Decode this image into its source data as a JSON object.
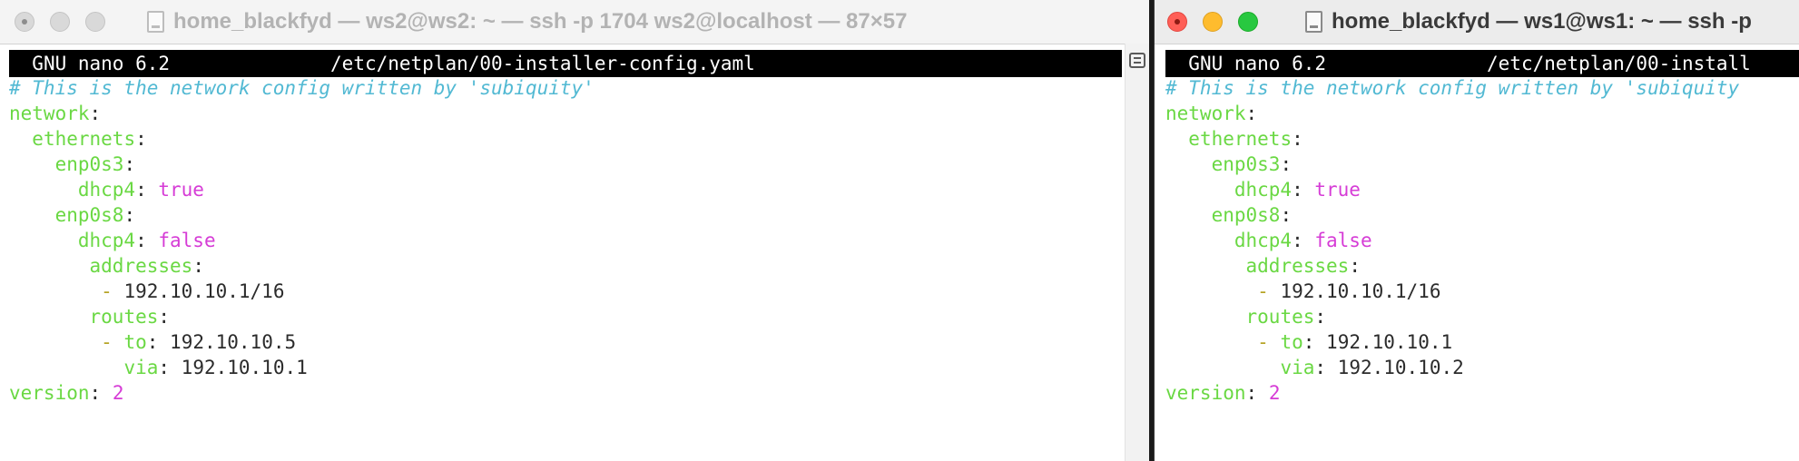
{
  "windows": [
    {
      "id": "ws2",
      "title": "home_blackfyd — ws2@ws2: ~ — ssh -p 1704 ws2@localhost — 87×57",
      "active": false,
      "nano": {
        "version_label": "GNU nano 6.2",
        "file_path": "/etc/netplan/00-installer-config.yaml"
      },
      "lines": [
        [
          {
            "c": "comment",
            "t": "# This is the network config written by 'subiquity'"
          }
        ],
        [
          {
            "c": "key",
            "t": "network"
          },
          {
            "c": "punc",
            "t": ":"
          }
        ],
        [
          {
            "c": "punc",
            "t": "  "
          },
          {
            "c": "key",
            "t": "ethernets"
          },
          {
            "c": "punc",
            "t": ":"
          }
        ],
        [
          {
            "c": "punc",
            "t": "    "
          },
          {
            "c": "key",
            "t": "enp0s3"
          },
          {
            "c": "punc",
            "t": ":"
          }
        ],
        [
          {
            "c": "punc",
            "t": "      "
          },
          {
            "c": "key",
            "t": "dhcp4"
          },
          {
            "c": "punc",
            "t": ": "
          },
          {
            "c": "bool",
            "t": "true"
          }
        ],
        [
          {
            "c": "punc",
            "t": "    "
          },
          {
            "c": "key",
            "t": "enp0s8"
          },
          {
            "c": "punc",
            "t": ":"
          }
        ],
        [
          {
            "c": "punc",
            "t": "      "
          },
          {
            "c": "key",
            "t": "dhcp4"
          },
          {
            "c": "punc",
            "t": ": "
          },
          {
            "c": "bool",
            "t": "false"
          }
        ],
        [
          {
            "c": "punc",
            "t": "       "
          },
          {
            "c": "key",
            "t": "addresses"
          },
          {
            "c": "punc",
            "t": ":"
          }
        ],
        [
          {
            "c": "punc",
            "t": "        "
          },
          {
            "c": "dash",
            "t": "- "
          },
          {
            "c": "val",
            "t": "192.10.10.1/16"
          }
        ],
        [
          {
            "c": "punc",
            "t": "       "
          },
          {
            "c": "key",
            "t": "routes"
          },
          {
            "c": "punc",
            "t": ":"
          }
        ],
        [
          {
            "c": "punc",
            "t": "        "
          },
          {
            "c": "dash",
            "t": "- "
          },
          {
            "c": "key",
            "t": "to"
          },
          {
            "c": "punc",
            "t": ": "
          },
          {
            "c": "val",
            "t": "192.10.10.5"
          }
        ],
        [
          {
            "c": "punc",
            "t": "          "
          },
          {
            "c": "key",
            "t": "via"
          },
          {
            "c": "punc",
            "t": ": "
          },
          {
            "c": "val",
            "t": "192.10.10.1"
          }
        ],
        [
          {
            "c": "key",
            "t": "version"
          },
          {
            "c": "punc",
            "t": ": "
          },
          {
            "c": "num",
            "t": "2"
          }
        ]
      ]
    },
    {
      "id": "ws1",
      "title": "home_blackfyd — ws1@ws1: ~ — ssh -p",
      "active": true,
      "nano": {
        "version_label": "GNU nano 6.2",
        "file_path": "/etc/netplan/00-install"
      },
      "lines": [
        [
          {
            "c": "comment",
            "t": "# This is the network config written by 'subiquity"
          }
        ],
        [
          {
            "c": "key",
            "t": "network"
          },
          {
            "c": "punc",
            "t": ":"
          }
        ],
        [
          {
            "c": "punc",
            "t": "  "
          },
          {
            "c": "key",
            "t": "ethernets"
          },
          {
            "c": "punc",
            "t": ":"
          }
        ],
        [
          {
            "c": "punc",
            "t": "    "
          },
          {
            "c": "key",
            "t": "enp0s3"
          },
          {
            "c": "punc",
            "t": ":"
          }
        ],
        [
          {
            "c": "punc",
            "t": "      "
          },
          {
            "c": "key",
            "t": "dhcp4"
          },
          {
            "c": "punc",
            "t": ": "
          },
          {
            "c": "bool",
            "t": "true"
          }
        ],
        [
          {
            "c": "punc",
            "t": "    "
          },
          {
            "c": "key",
            "t": "enp0s8"
          },
          {
            "c": "punc",
            "t": ":"
          }
        ],
        [
          {
            "c": "punc",
            "t": "      "
          },
          {
            "c": "key",
            "t": "dhcp4"
          },
          {
            "c": "punc",
            "t": ": "
          },
          {
            "c": "bool",
            "t": "false"
          }
        ],
        [
          {
            "c": "punc",
            "t": "       "
          },
          {
            "c": "key",
            "t": "addresses"
          },
          {
            "c": "punc",
            "t": ":"
          }
        ],
        [
          {
            "c": "punc",
            "t": "        "
          },
          {
            "c": "dash",
            "t": "- "
          },
          {
            "c": "val",
            "t": "192.10.10.1/16"
          }
        ],
        [
          {
            "c": "punc",
            "t": "       "
          },
          {
            "c": "key",
            "t": "routes"
          },
          {
            "c": "punc",
            "t": ":"
          }
        ],
        [
          {
            "c": "punc",
            "t": "        "
          },
          {
            "c": "dash",
            "t": "- "
          },
          {
            "c": "key",
            "t": "to"
          },
          {
            "c": "punc",
            "t": ": "
          },
          {
            "c": "val",
            "t": "192.10.10.1"
          }
        ],
        [
          {
            "c": "punc",
            "t": "          "
          },
          {
            "c": "key",
            "t": "via"
          },
          {
            "c": "punc",
            "t": ": "
          },
          {
            "c": "val",
            "t": "192.10.10.2"
          }
        ],
        [
          {
            "c": "key",
            "t": "version"
          },
          {
            "c": "punc",
            "t": ": "
          },
          {
            "c": "num",
            "t": "2"
          }
        ]
      ]
    }
  ],
  "colors": {
    "comment": "#52b9d3",
    "key": "#6ad843",
    "bool": "#d63cd6",
    "dash": "#b5a323",
    "nano_header_bg": "#000000"
  }
}
